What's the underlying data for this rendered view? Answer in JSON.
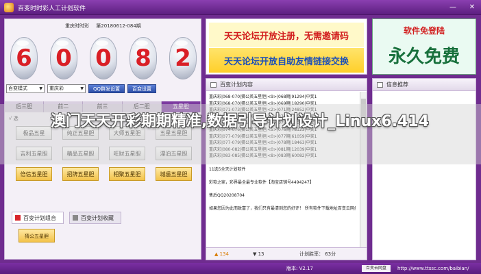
{
  "window": {
    "title": "百变时时彩人工计划软件",
    "minimize": "—",
    "close": "✕"
  },
  "draw": {
    "label": "重庆时时彩",
    "period": "第20180612-084期",
    "numbers": [
      "6",
      "0",
      "0",
      "8",
      "2"
    ]
  },
  "controls": {
    "select1": "百变模式",
    "select2": "重庆彩",
    "qq_button": "QQ群发设置",
    "settings_button": "百变设置"
  },
  "tabs": [
    "后三胆",
    "前二",
    "前三",
    "后二胆",
    "五星胆"
  ],
  "active_tab": 4,
  "option_label": "√ 选",
  "grid_buttons": [
    {
      "label": "极品五星",
      "gold": false
    },
    {
      "label": "纯正五星胆",
      "gold": false
    },
    {
      "label": "大师五星胆",
      "gold": false
    },
    {
      "label": "五星五星胆",
      "gold": false
    },
    {
      "label": "吉利五星胆",
      "gold": false
    },
    {
      "label": "精品五星胆",
      "gold": false
    },
    {
      "label": "旺财五星胆",
      "gold": false
    },
    {
      "label": "漂泊五星胆",
      "gold": false
    },
    {
      "label": "倍信五星胆",
      "gold": true
    },
    {
      "label": "招牌五星胆",
      "gold": true
    },
    {
      "label": "相聚五星胆",
      "gold": true
    },
    {
      "label": "城遥五星胆",
      "gold": true
    }
  ],
  "plan_tabs": {
    "combo": "百变计划组合",
    "favorites": "百变计划收藏"
  },
  "mini_button": "猜公五星胆",
  "ads": {
    "line1": "天天论坛开放注册，无需邀请码",
    "line2": "天天论坛开放自助友情链接交换",
    "free_top": "软件免登陆",
    "free_big": "永久免费"
  },
  "plan_panel": {
    "title": "百变计划内容",
    "lines": [
      "重庆彩|068-070|猜公英五星胆|<9>|068期|91294|中奖1",
      "重庆彩|068-070|猜公英五星胆|<9>|069期|18290|中奖1",
      "重庆彩|071-073|猜公英五星胆|<2>|071期|24852|中奖1",
      "重庆彩|074-076|猜公英五星胆|<5>|074期|22546|中奖1",
      "重庆彩|074-076|猜公英五星胆|<5>|075期|59043|中奖1",
      "重庆彩|074-076|猜公英五星胆|<5>|076期|78123|中奖1",
      "重庆彩|077-079|猜公英五星胆|<0>|077期|61059|中奖1",
      "重庆彩|077-079|猜公英五星胆|<0>|078期|18463|中奖1",
      "重庆彩|080-082|猜公英五星胆|<0>|081期|12039|中奖1",
      "重庆彩|083-085|猜公英五星胆|<8>|083期|60082|中奖1",
      "",
      "11选5全天计划软件",
      "",
      "彩软之家，彩界最全最专业软件【淘宝店铺号4494247】",
      "",
      "售后QQ20208704",
      "",
      "如果您因为此而致富了，我们只有最清到您的好评！ 所有软件下载地址百变云网盘"
    ],
    "likes": "▲ 134",
    "dislikes": "▼ 13",
    "count": "计划胜率：  63分"
  },
  "info_panel": {
    "title": "信息推荐"
  },
  "status": {
    "version": "版本: V2.17",
    "box": "百变云网盘",
    "url": "http://www.ttssc.com/baibian/"
  },
  "overlay_caption": "澳门天天开彩期期精准,数据引导计划设计_Linux6.414",
  "colors": {
    "title_purple": "#6f2c8f",
    "ball_red": "#d91f26",
    "gold": "#f3c24a",
    "ad_green": "#18703c"
  }
}
